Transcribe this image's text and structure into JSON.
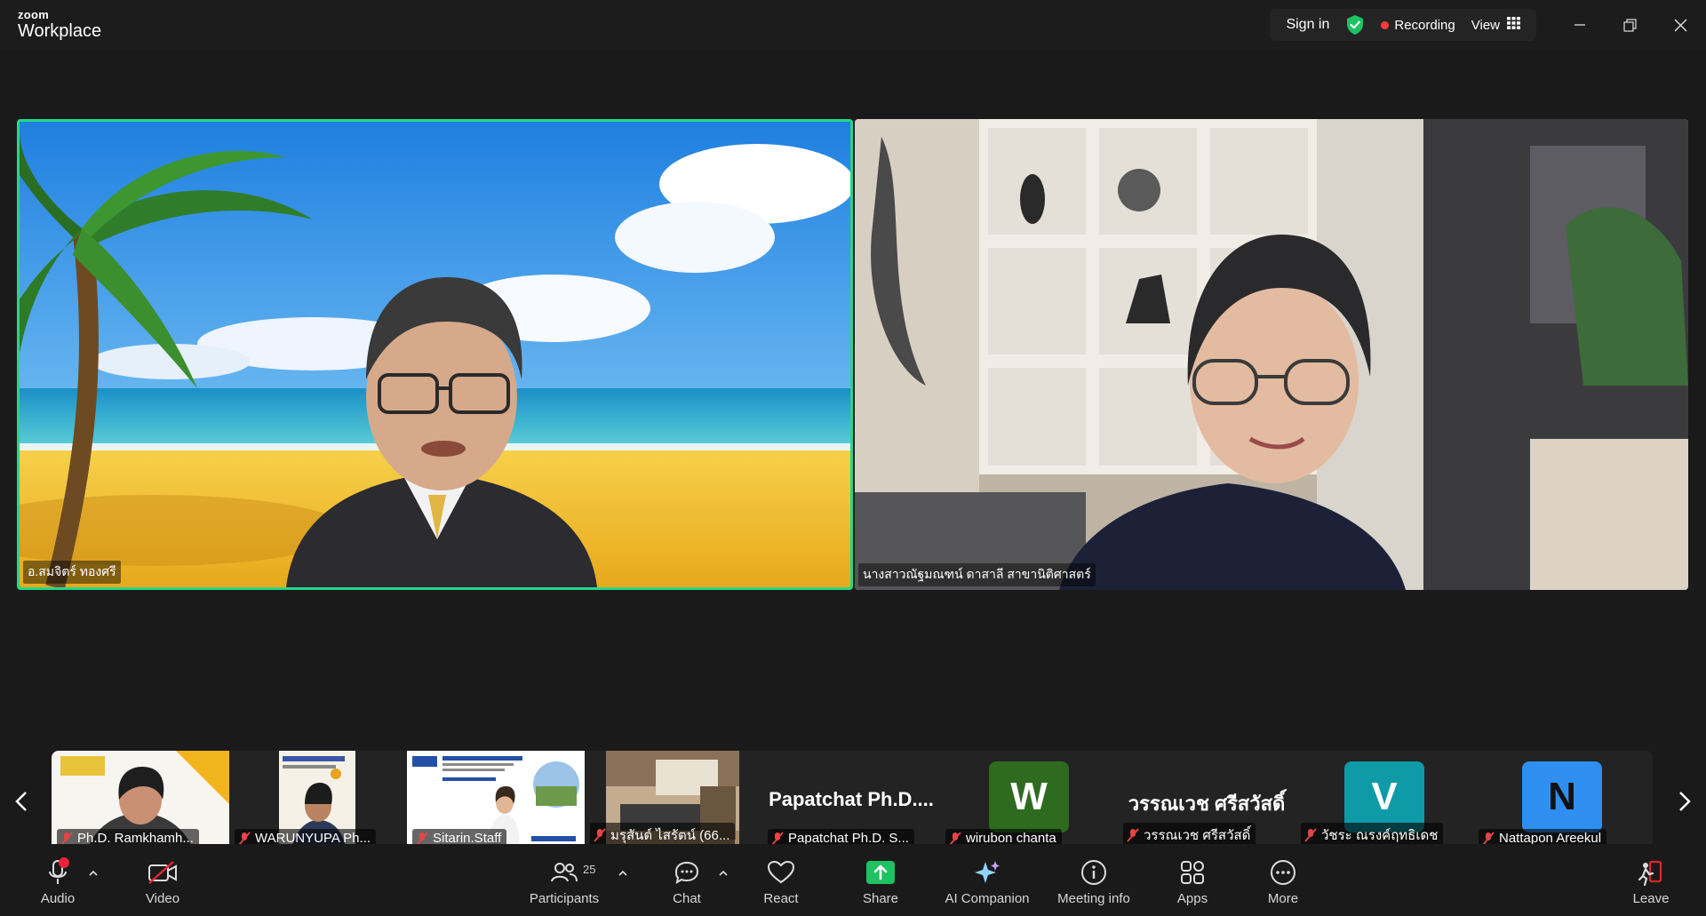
{
  "titlebar": {
    "brand_small": "zoom",
    "brand_large": "Workplace",
    "signin": "Sign in",
    "recording": "Recording",
    "view": "View",
    "icons": [
      "shield-check-icon",
      "grid-icon",
      "minimize-icon",
      "restore-icon",
      "close-icon"
    ],
    "accent_green": "#23d88a",
    "recording_color": "#ff3b3b"
  },
  "main_tiles": [
    {
      "name": "อ.สมจิตร์ ทองศรี",
      "active_speaker": true
    },
    {
      "name": "นางสาวณัฐมณฑน์ ดาสาลี สาขานิติศาสตร์",
      "active_speaker": false
    }
  ],
  "thumbnails": [
    {
      "label": "Ph.D. Ramkhamh...",
      "kind": "video"
    },
    {
      "label": "WARUNYUPA Ph...",
      "kind": "video"
    },
    {
      "label": "Sitarin.Staff",
      "kind": "video"
    },
    {
      "label": "มรุสันต์ ไสรัตน์ (66...",
      "kind": "video"
    },
    {
      "label": "Papatchat Ph.D. S...",
      "display": "Papatchat  Ph.D....",
      "kind": "name"
    },
    {
      "label": "wirubon chanta",
      "avatar_letter": "W",
      "avatar_color": "#2e6b1f",
      "kind": "avatar"
    },
    {
      "label": "วรรณเวช ศรีสวัสดิ์",
      "display": "วรรณเวช ศรีสวัสดิ์",
      "kind": "name"
    },
    {
      "label": "วัชระ ณรงค์ฤทธิเดช",
      "avatar_letter": "V",
      "avatar_color": "#0f9aa8",
      "kind": "avatar"
    },
    {
      "label": "Nattapon Areekul",
      "avatar_letter": "N",
      "avatar_color": "#2f8ff0",
      "kind": "avatar"
    }
  ],
  "toolbar": {
    "audio": "Audio",
    "video": "Video",
    "participants": "Participants",
    "participants_count": "25",
    "chat": "Chat",
    "react": "React",
    "share": "Share",
    "ai_companion": "AI Companion",
    "meeting_info": "Meeting info",
    "apps": "Apps",
    "more": "More",
    "leave": "Leave",
    "share_color": "#1ec262",
    "leave_color": "#e02828"
  }
}
